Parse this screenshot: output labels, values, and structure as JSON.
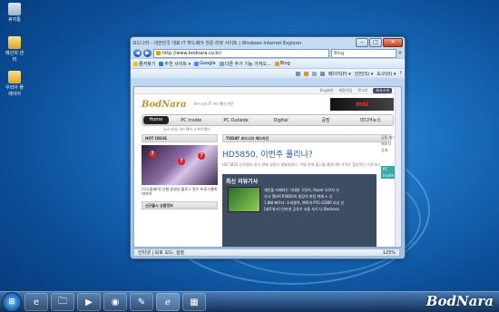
{
  "desktop": {
    "icons": [
      {
        "label": "휴지통"
      },
      {
        "label": "메신저 센터"
      },
      {
        "label": "우리아 플레이어"
      }
    ]
  },
  "browser": {
    "title": "보드나라 - 대한민국 대표 IT 하드웨어 전문 리뷰 사이트 | Windows Internet Explorer",
    "address": "http://www.bodnara.co.kr/",
    "search_placeholder": "Bing",
    "favorites": [
      {
        "label": "즐겨찾기"
      },
      {
        "label": "추천 사이트 ▾"
      },
      {
        "label": "Google"
      },
      {
        "label": "다른 추가 기능 가져오..."
      },
      {
        "label": "Bing"
      }
    ],
    "commands": [
      "페이지(P) ▾",
      "안전(S) ▾",
      "도구(O) ▾",
      "?"
    ],
    "status": {
      "left": "인터넷 | 보호 모드: 설정",
      "zoom": "125%"
    }
  },
  "site": {
    "topline": [
      "English",
      "회원가입",
      "로그인"
    ],
    "topline_pill": "회사소개",
    "logo": "BodNara",
    "tagline": "보드나라 IT 하드웨어 전문",
    "banner": "msi",
    "nav": [
      {
        "label": "Home"
      },
      {
        "label": "PC Inside"
      },
      {
        "label": "PC Outside"
      },
      {
        "label": "Digital"
      },
      {
        "label": "공장"
      },
      {
        "label": "미디어뉴스"
      }
    ],
    "subnav": "뉴스/리뷰    하드웨어    소프트웨어",
    "hot_issue": {
      "header": "HOT ISSUE",
      "caption": "[디스플레이] 신형 동영상 블로그 필수 프로그램에 대하여",
      "list_header": "신규출시 상품정보"
    },
    "today": {
      "header": "TODAY 보드나라 헤드라인",
      "headline": "HD5850, 이번주 풀리나?",
      "summary": "HD 5850 신모델의 정식 판매 일정이 발표되었다. 이달 안에 출시될 예정이며 가격은 합리적인 수준이다."
    },
    "review": {
      "header": "최신 리뷰기사",
      "items": [
        "개인을 지배하는 거대한 구렁이, Razer 오로치 신",
        "신나 엘바트R5800의 빌링의 현장 취재 + 신",
        "1.8배 빠르다. 오버클럭, MSI의 P55-GD80 리뷰 신",
        "[네트워크] 인터넷 공유기 사용 지식 나 Bodnara"
      ]
    },
    "side": {
      "items": [
        "공통 대기",
        "제조사",
        "공개"
      ],
      "teal": "PC Inside"
    }
  },
  "taskbar": {
    "start": "⊞",
    "buttons": [
      "e",
      "🗀",
      "▶",
      "◉",
      "✎",
      "ℯ",
      "▦"
    ],
    "watermark": "BodNara"
  }
}
